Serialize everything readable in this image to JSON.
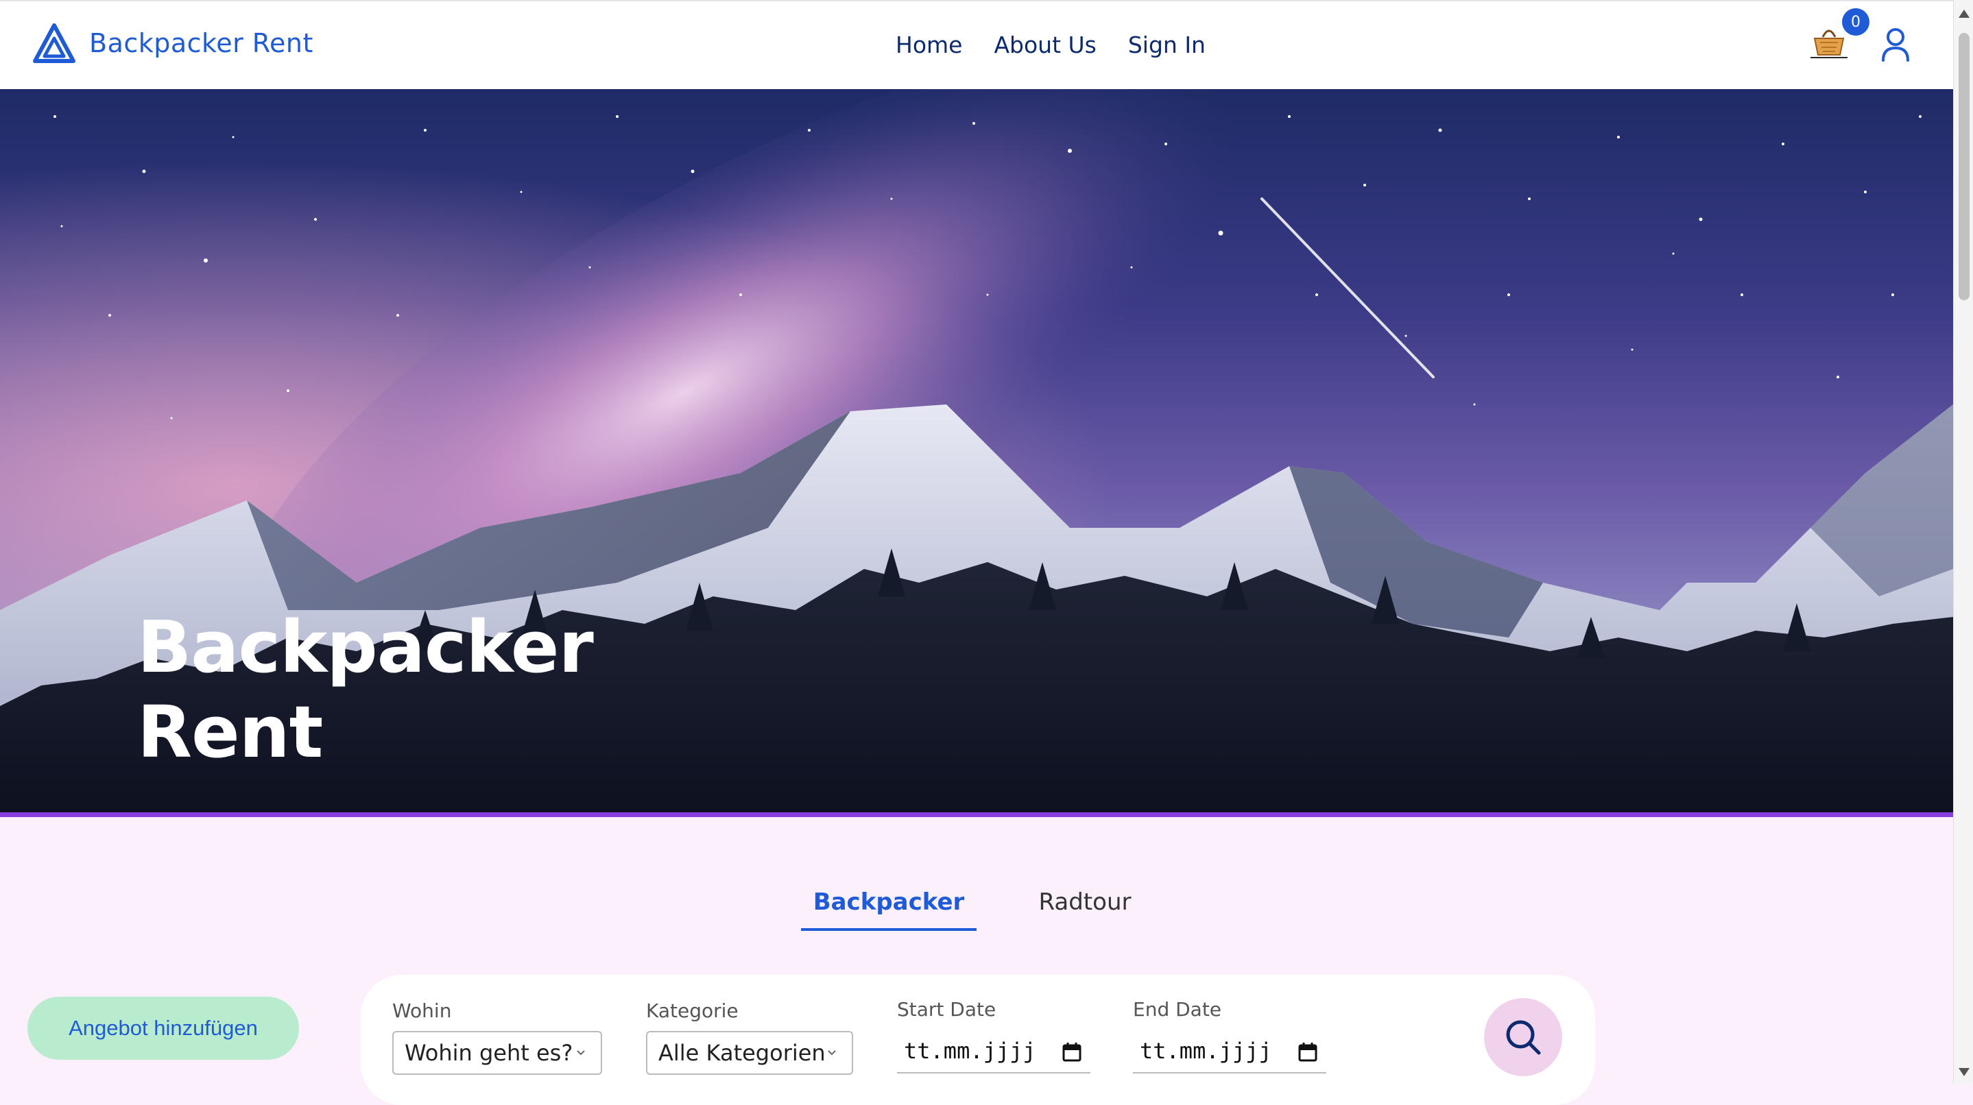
{
  "navbar": {
    "brand": "Backpacker Rent",
    "links": [
      "Home",
      "About Us",
      "Sign In"
    ],
    "cart_count": "0"
  },
  "hero": {
    "title_line1": "Backpacker",
    "title_line2": "Rent"
  },
  "tabs": [
    "Backpacker",
    "Radtour"
  ],
  "active_tab": "Backpacker",
  "add_offer_label": "Angebot hinzufügen",
  "search": {
    "wohin_label": "Wohin",
    "wohin_value": "Wohin geht es?",
    "kategorie_label": "Kategorie",
    "kategorie_value": "Alle Kategorien",
    "start_label": "Start Date",
    "start_value": "tt.mm.jjjj",
    "end_label": "End Date",
    "end_value": "tt.mm.jjjj"
  },
  "colors": {
    "brand": "#1f5bd6",
    "nav_text": "#0d2a6f",
    "hero_border": "#8b3fe0",
    "page_bg": "#fdf0fd",
    "add_button_bg": "#b9ecce",
    "search_button_bg": "#f0d2ec"
  },
  "icons": {
    "logo": "triangle-logo-icon",
    "cart": "basket-icon",
    "user": "user-icon",
    "search": "search-icon",
    "chevron": "chevron-down-icon",
    "calendar": "calendar-icon"
  }
}
